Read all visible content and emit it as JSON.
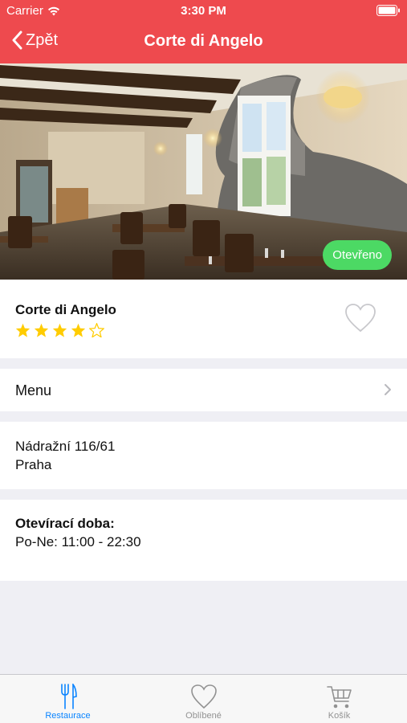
{
  "status": {
    "carrier": "Carrier",
    "time": "3:30 PM"
  },
  "nav": {
    "back_label": "Zpět",
    "title": "Corte di Angelo"
  },
  "hero": {
    "badge": "Otevřeno",
    "badge_color": "#4cd964"
  },
  "restaurant": {
    "name": "Corte di Angelo",
    "rating": 4,
    "rating_max": 5,
    "favorite": false
  },
  "menu": {
    "label": "Menu"
  },
  "address": {
    "street": "Nádražní 116/61",
    "city": "Praha"
  },
  "hours": {
    "title": "Otevírací doba:",
    "value": "Po-Ne: 11:00 - 22:30"
  },
  "tabs": [
    {
      "label": "Restaurace",
      "icon": "fork-knife-icon",
      "active": true
    },
    {
      "label": "Oblíbené",
      "icon": "heart-icon",
      "active": false
    },
    {
      "label": "Košík",
      "icon": "cart-icon",
      "active": false
    }
  ],
  "colors": {
    "brand": "#ee4a4e",
    "accent": "#0a84ff",
    "star": "#ffcc00"
  }
}
